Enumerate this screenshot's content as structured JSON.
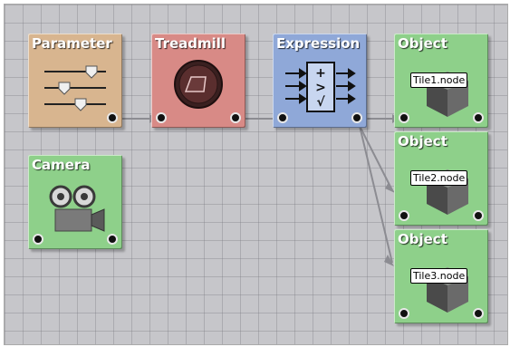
{
  "canvas": {
    "background": "#c6c6ca"
  },
  "nodes": {
    "parameter": {
      "title": "Parameter",
      "color": "#d8b58f"
    },
    "treadmill": {
      "title": "Treadmill",
      "color": "#d88a86"
    },
    "expression": {
      "title": "Expression",
      "color": "#8fa8d8"
    },
    "camera": {
      "title": "Camera",
      "color": "#8ed08a"
    },
    "object1": {
      "title": "Object",
      "file": "Tile1.node",
      "color": "#8ed08a"
    },
    "object2": {
      "title": "Object",
      "file": "Tile2.node",
      "color": "#8ed08a"
    },
    "object3": {
      "title": "Object",
      "file": "Tile3.node",
      "color": "#8ed08a"
    }
  },
  "icons": {
    "parameter": "slider-icon",
    "treadmill": "treadmill-icon",
    "expression": "expression-icon",
    "camera": "camera-icon",
    "object": "cube-icon"
  }
}
